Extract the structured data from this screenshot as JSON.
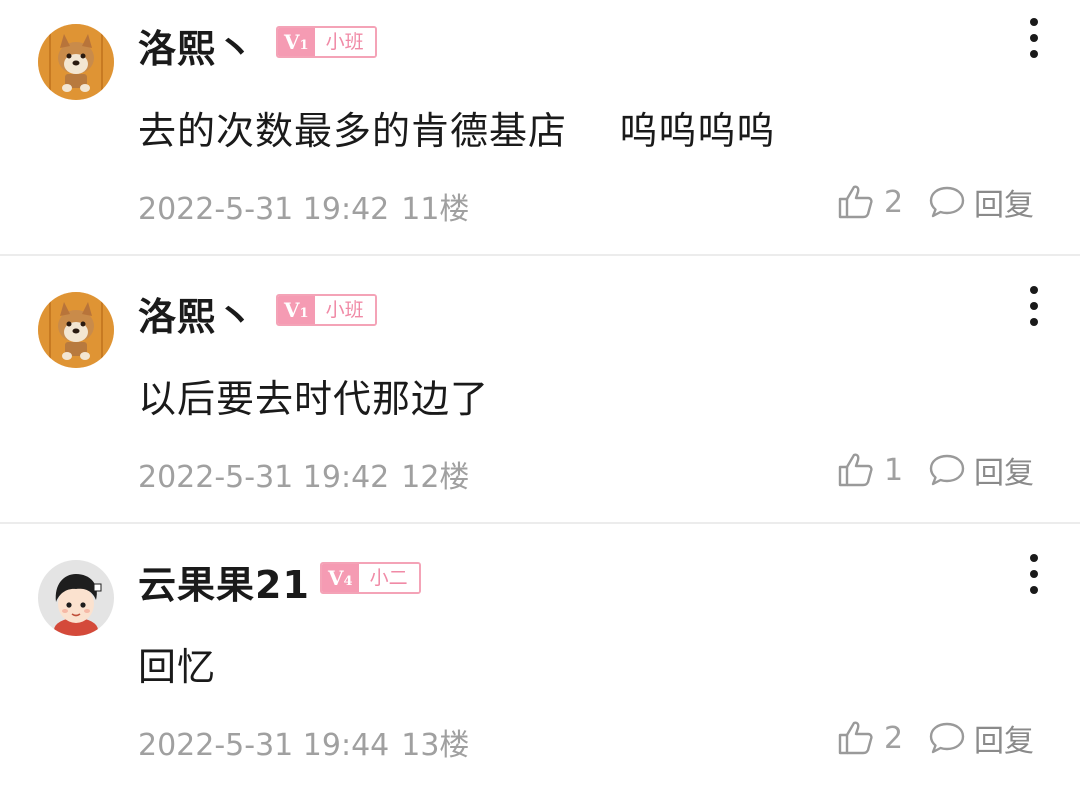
{
  "comments": [
    {
      "username": "洛熙丶",
      "level_badge": "V",
      "level_num": "1",
      "rank": "小班",
      "content": "去的次数最多的肯德基店    呜呜呜呜",
      "timestamp": "2022-5-31 19:42",
      "floor": "11楼",
      "likes": "2",
      "reply_label": "回复",
      "avatar_icon": "shiba-dog-avatar"
    },
    {
      "username": "洛熙丶",
      "level_badge": "V",
      "level_num": "1",
      "rank": "小班",
      "content": "以后要去时代那边了",
      "timestamp": "2022-5-31 19:42",
      "floor": "12楼",
      "likes": "1",
      "reply_label": "回复",
      "avatar_icon": "shiba-dog-avatar"
    },
    {
      "username": "云果果21",
      "level_badge": "V",
      "level_num": "4",
      "rank": "小二",
      "content": "回忆",
      "timestamp": "2022-5-31 19:44",
      "floor": "13楼",
      "likes": "2",
      "reply_label": "回复",
      "avatar_icon": "cartoon-kid-avatar"
    }
  ],
  "icons": {
    "more": "more-vertical-icon",
    "like": "thumbs-up-icon",
    "reply": "speech-bubble-icon"
  },
  "colors": {
    "badge_pink": "#f59bb3",
    "badge_border": "#f4a3b7",
    "badge_text": "#f08aa6",
    "meta_gray": "#a0a0a0",
    "text_dark": "#1a1a1a"
  }
}
